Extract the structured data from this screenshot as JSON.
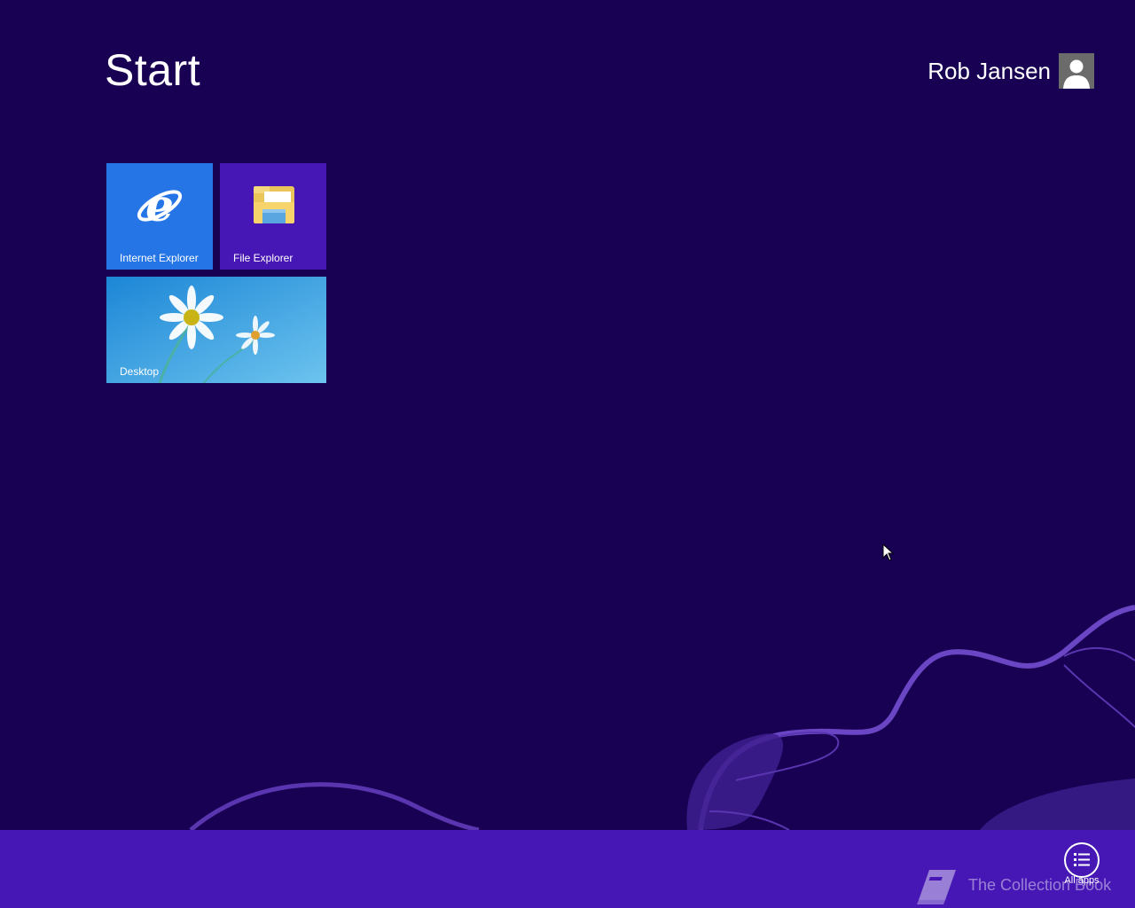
{
  "screen": {
    "title": "Start",
    "background": "#180052",
    "accent": "#4617b4"
  },
  "user": {
    "name": "Rob Jansen",
    "avatar_icon": "user-avatar-icon"
  },
  "tiles": [
    {
      "label": "Internet Explorer",
      "icon": "internet-explorer-icon",
      "color": "#2575e7"
    },
    {
      "label": "File Explorer",
      "icon": "file-explorer-icon",
      "color": "#4617b4"
    },
    {
      "label": "Desktop",
      "icon": "desktop-wallpaper",
      "color": "#2a9ad8"
    }
  ],
  "appbar": {
    "all_apps_label": "All apps",
    "all_apps_icon": "list-icon"
  },
  "watermark": {
    "text": "The Collection Book",
    "icon": "book-icon"
  }
}
